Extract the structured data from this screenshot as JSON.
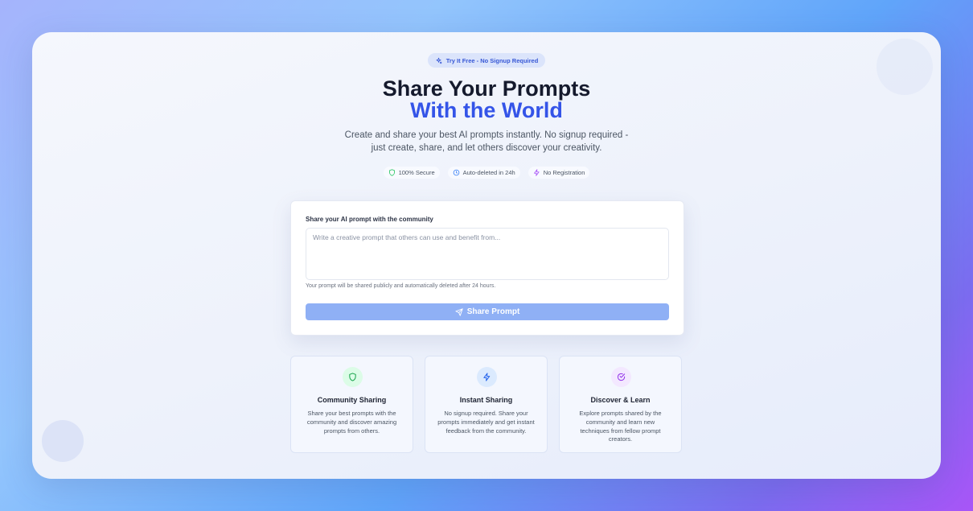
{
  "badge_top": {
    "label": "Try It Free - No Signup Required",
    "icon": "sparkle-icon",
    "color": "#3858d6"
  },
  "hero": {
    "title_line1": "Share Your Prompts",
    "title_line2": "With the World",
    "title_accent_color": "#3454e8",
    "subtitle_line1": "Create and share your best AI prompts instantly. No signup required -",
    "subtitle_line2": "just create, share, and let others discover your creativity."
  },
  "features_badges": [
    {
      "label": "100% Secure",
      "icon": "shield-icon",
      "color": "#22c55e"
    },
    {
      "label": "Auto-deleted in 24h",
      "icon": "clock-icon",
      "color": "#3b82f6"
    },
    {
      "label": "No Registration",
      "icon": "zap-icon",
      "color": "#a855f7"
    }
  ],
  "form": {
    "label": "Share your AI prompt with the community",
    "placeholder": "Write a creative prompt that others can use and benefit from...",
    "value": "",
    "helper": "Your prompt will be shared publicly and automatically deleted after 24 hours.",
    "submit_label": "Share Prompt",
    "submit_icon": "send-icon",
    "submit_color": "#8fb0f5"
  },
  "feature_cards": [
    {
      "title": "Community Sharing",
      "description": "Share your best prompts with the community and discover amazing prompts from others.",
      "icon": "shield-icon",
      "icon_color": "#16a34a",
      "icon_bg": "#dcfce7"
    },
    {
      "title": "Instant Sharing",
      "description": "No signup required. Share your prompts immediately and get instant feedback from the community.",
      "icon": "zap-icon",
      "icon_color": "#2563eb",
      "icon_bg": "#dbeafe"
    },
    {
      "title": "Discover & Learn",
      "description": "Explore prompts shared by the community and learn new techniques from fellow prompt creators.",
      "icon": "check-circle-icon",
      "icon_color": "#9333ea",
      "icon_bg": "#f3e8ff"
    }
  ]
}
